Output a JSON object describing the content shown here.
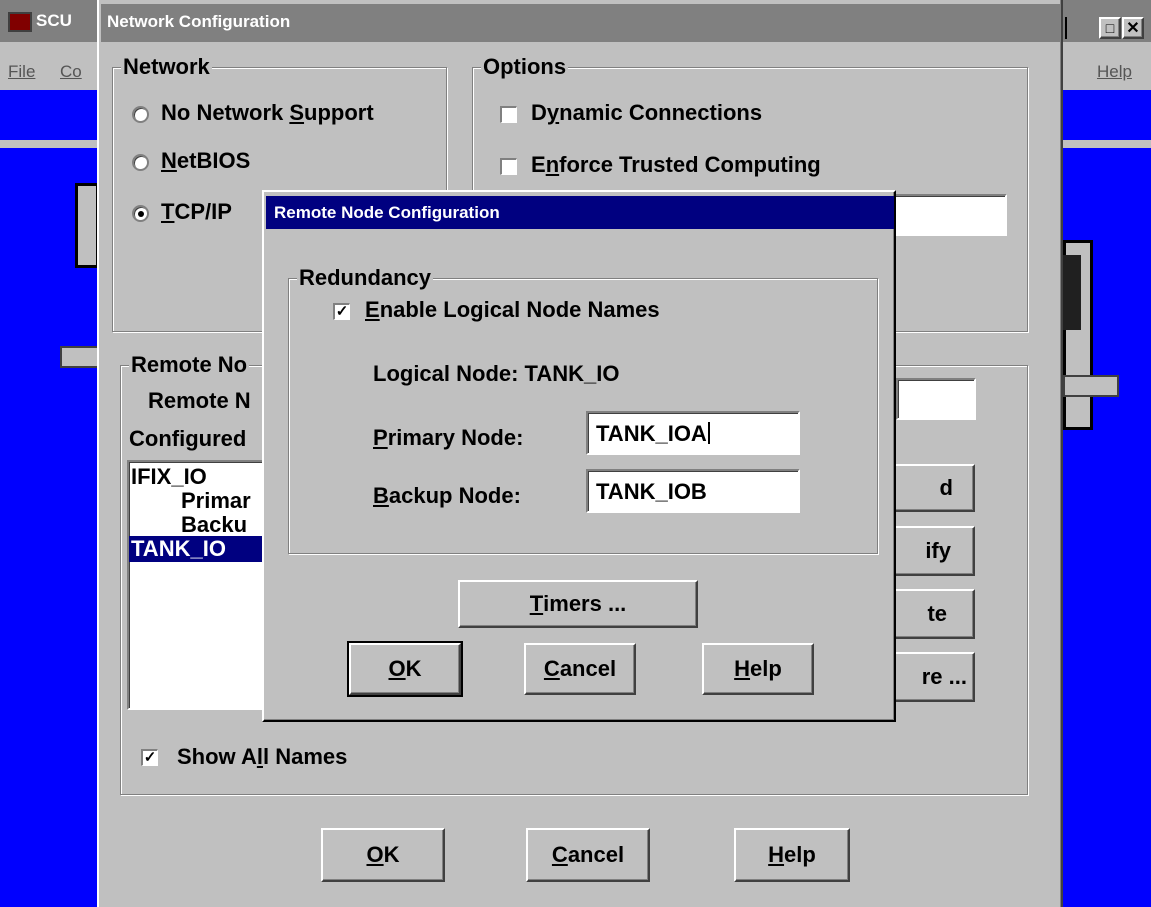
{
  "app": {
    "title_fragment": "SCU",
    "menu_left": [
      "File",
      "Co"
    ],
    "menu_right": "Help"
  },
  "network_config": {
    "title": "Network Configuration",
    "network_group": {
      "label": "Network",
      "options": [
        "No Network Support",
        "NetBIOS",
        "TCP/IP"
      ],
      "selected": "TCP/IP"
    },
    "options_group": {
      "label": "Options",
      "dynamic_connections": {
        "label": "Dynamic Connections",
        "checked": false
      },
      "enforce_trusted": {
        "label": "Enforce Trusted Computing",
        "checked": false
      }
    },
    "remote_group": {
      "label_fragment": "Remote No",
      "name_label_fragment": "Remote N",
      "configured_label_fragment": "Configured",
      "list": [
        "IFIX_IO",
        "Primar",
        "Backu",
        "TANK_IO"
      ],
      "selected_index": 3,
      "side_buttons": [
        "d",
        "ify",
        "te",
        "re ..."
      ],
      "show_all_names": {
        "label": "Show All Names",
        "checked": true
      }
    },
    "buttons": {
      "ok": "OK",
      "cancel": "Cancel",
      "help": "Help"
    }
  },
  "remote_node_config": {
    "title": "Remote Node Configuration",
    "redundancy_label": "Redundancy",
    "enable_logical": {
      "label": "Enable Logical Node Names",
      "checked": true
    },
    "logical_node": "Logical Node: TANK_IO",
    "primary_label": "Primary Node:",
    "primary_value": "TANK_IOA",
    "backup_label": "Backup Node:",
    "backup_value": "TANK_IOB",
    "buttons": {
      "timers": "Timers ...",
      "ok": "OK",
      "cancel": "Cancel",
      "help": "Help"
    }
  },
  "colors": {
    "desktop_blue": "#0000ff",
    "active_title": "#000080",
    "inactive_title": "#808080"
  }
}
